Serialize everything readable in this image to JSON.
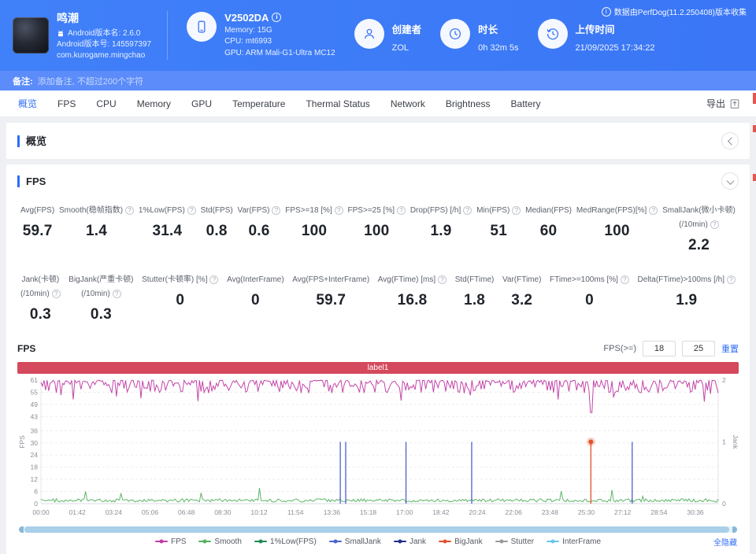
{
  "header": {
    "app": {
      "name": "鸣潮",
      "version_name": "Android版本名: 2.6.0",
      "version_code": "Android版本号: 145597397",
      "package": "com.kurogame.mingchao"
    },
    "device": {
      "name": "V2502DA",
      "memory": "Memory: 15G",
      "cpu": "CPU: mt6993",
      "gpu": "GPU: ARM Mali-G1-Ultra MC12"
    },
    "creator": {
      "label": "创建者",
      "value": "ZOL"
    },
    "duration": {
      "label": "时长",
      "value": "0h 32m 5s"
    },
    "upload": {
      "label": "上传时间",
      "value": "21/09/2025 17:34:22"
    },
    "collector_note": "数据由PerfDog(11.2.250408)版本收集"
  },
  "note_bar": {
    "label": "备注:",
    "placeholder": "添加备注, 不超过200个字符"
  },
  "tabs": {
    "items": [
      "概览",
      "FPS",
      "CPU",
      "Memory",
      "GPU",
      "Temperature",
      "Thermal Status",
      "Network",
      "Brightness",
      "Battery"
    ],
    "active": "概览",
    "export_label": "导出"
  },
  "sections": {
    "overview": "概览",
    "fps": "FPS"
  },
  "metrics": {
    "row1": [
      {
        "label": "Avg(FPS)",
        "value": "59.7",
        "help": false
      },
      {
        "label": "Smooth(稳帧指数)",
        "value": "1.4",
        "help": true
      },
      {
        "label": "1%Low(FPS)",
        "value": "31.4",
        "help": true
      },
      {
        "label": "Std(FPS)",
        "value": "0.8",
        "help": false
      },
      {
        "label": "Var(FPS)",
        "value": "0.6",
        "help": true
      },
      {
        "label": "FPS>=18 [%]",
        "value": "100",
        "help": true
      },
      {
        "label": "FPS>=25 [%]",
        "value": "100",
        "help": true
      },
      {
        "label": "Drop(FPS) [/h]",
        "value": "1.9",
        "help": true
      },
      {
        "label": "Min(FPS)",
        "value": "51",
        "help": true
      },
      {
        "label": "Median(FPS)",
        "value": "60",
        "help": false
      },
      {
        "label": "MedRange(FPS)[%]",
        "value": "100",
        "help": true
      },
      {
        "label": "SmallJank(微小卡顿)\n(/10min)",
        "value": "2.2",
        "help": true
      }
    ],
    "row2": [
      {
        "label": "Jank(卡顿)\n(/10min)",
        "value": "0.3",
        "help": true
      },
      {
        "label": "BigJank(严重卡顿)\n(/10min)",
        "value": "0.3",
        "help": true
      },
      {
        "label": "Stutter(卡顿率) [%]",
        "value": "0",
        "help": true
      },
      {
        "label": "Avg(InterFrame)",
        "value": "0",
        "help": false
      },
      {
        "label": "Avg(FPS+InterFrame)",
        "value": "59.7",
        "help": false
      },
      {
        "label": "Avg(FTime) [ms]",
        "value": "16.8",
        "help": true
      },
      {
        "label": "Std(FTime)",
        "value": "1.8",
        "help": false
      },
      {
        "label": "Var(FTime)",
        "value": "3.2",
        "help": false
      },
      {
        "label": "FTime>=100ms [%]",
        "value": "0",
        "help": true
      },
      {
        "label": "Delta(FTime)>100ms [/h]",
        "value": "1.9",
        "help": true
      }
    ]
  },
  "chart_data": {
    "type": "line",
    "section_label": "FPS",
    "banner_label": "label1",
    "banner_color": "#d5495c",
    "duration_label": "0h 32m 5s",
    "x_ticks": [
      "00:00",
      "01:42",
      "03:24",
      "05:06",
      "06:48",
      "08:30",
      "10:12",
      "11:54",
      "13:36",
      "15:18",
      "17:00",
      "18:42",
      "20:24",
      "22:06",
      "23:48",
      "25:30",
      "27:12",
      "28:54",
      "30:36"
    ],
    "x_total_seconds": 1900,
    "x_tick_interval_seconds": 102,
    "y_left": {
      "label": "FPS",
      "ticks": [
        61,
        55,
        49,
        43,
        36,
        30,
        24,
        18,
        12,
        6,
        0
      ],
      "max": 61
    },
    "y_right": {
      "label": "Jank",
      "ticks": [
        2,
        1,
        0
      ],
      "max": 2
    },
    "series": [
      {
        "name": "FPS",
        "color": "#c03ba4",
        "kind": "noisy-line",
        "baseline": 60,
        "band": [
          55,
          61
        ],
        "avg": 59.7,
        "min": 51,
        "dip": {
          "t": 0.812,
          "value": 45
        }
      },
      {
        "name": "Smooth",
        "color": "#55b15f",
        "kind": "noisy-line-low",
        "baseline": 1.4
      },
      {
        "name": "1%Low(FPS)",
        "color": "#1d8a55",
        "kind": "hidden",
        "value": 31.4
      },
      {
        "name": "SmallJank",
        "color": "#4d61cf",
        "kind": "event-spike",
        "events_t": [
          0.442,
          0.45,
          0.539,
          0.636,
          0.873
        ],
        "spike_value": 1
      },
      {
        "name": "Jank",
        "color": "#23308e",
        "kind": "event-spike",
        "events_t": [],
        "spike_value": 1
      },
      {
        "name": "BigJank",
        "color": "#e4502e",
        "kind": "event-dot",
        "events_t": [
          0.812
        ],
        "spike_value": 1
      },
      {
        "name": "Stutter",
        "color": "#999999",
        "kind": "hidden"
      },
      {
        "name": "InterFrame",
        "color": "#6cc6ec",
        "kind": "hidden"
      }
    ],
    "controls": {
      "fps_ge_label": "FPS(>=)",
      "threshold1": "18",
      "threshold2": "25",
      "reset_label": "重置",
      "hide_all_label": "全隐藏"
    }
  },
  "misc": {
    "help_glyph": "?",
    "info_glyph": "i"
  }
}
